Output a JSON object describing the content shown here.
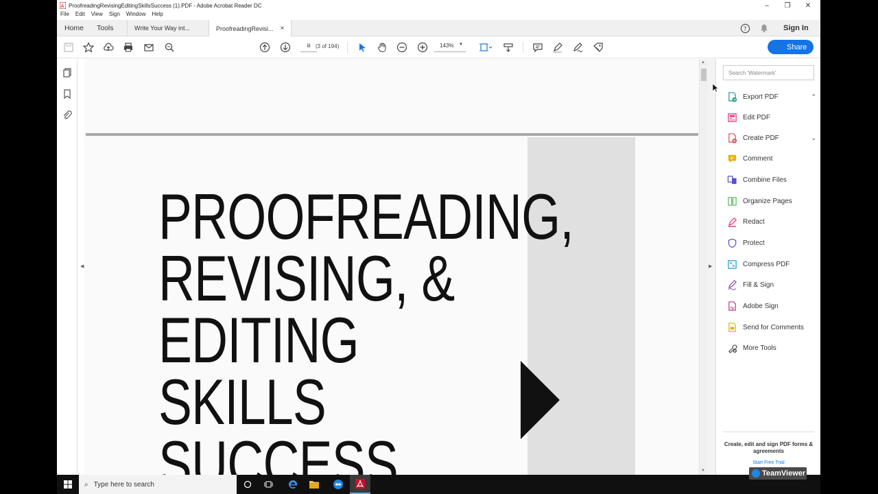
{
  "window": {
    "title": "ProofreadingRevisingEditingSkillsSuccess (1).PDF - Adobe Acrobat Reader DC",
    "minimize": "–",
    "maximize": "❐",
    "close": "✕"
  },
  "menu": [
    "File",
    "Edit",
    "View",
    "Sign",
    "Window",
    "Help"
  ],
  "tabs": {
    "home": "Home",
    "tools": "Tools",
    "documents": [
      {
        "label": "Write Your Way int...",
        "active": false
      },
      {
        "label": "ProofreadingRevisi...",
        "active": true,
        "close": "×"
      }
    ],
    "sign_in": "Sign In"
  },
  "toolbar": {
    "page_input": "iii",
    "page_count": "(3 of 194)",
    "zoom": "143%",
    "share": "Share"
  },
  "document": {
    "title_lines": [
      "PROOFREADING,",
      "REVISING, &",
      "EDITING",
      "SKILLS",
      "SUCCESS"
    ]
  },
  "right_panel": {
    "search_placeholder": "Search 'Watermark'",
    "tools": [
      {
        "label": "Export PDF",
        "icon": "export-pdf-icon",
        "color": "#1a9c8c",
        "chevron": "⌃"
      },
      {
        "label": "Edit PDF",
        "icon": "edit-pdf-icon",
        "color": "#e0337a",
        "chevron": ""
      },
      {
        "label": "Create PDF",
        "icon": "create-pdf-icon",
        "color": "#e34850",
        "chevron": "⌄"
      },
      {
        "label": "Comment",
        "icon": "comment-icon",
        "color": "#e8b000",
        "chevron": ""
      },
      {
        "label": "Combine Files",
        "icon": "combine-files-icon",
        "color": "#5a4fcf",
        "chevron": ""
      },
      {
        "label": "Organize Pages",
        "icon": "organize-pages-icon",
        "color": "#5cb85c",
        "chevron": ""
      },
      {
        "label": "Redact",
        "icon": "redact-icon",
        "color": "#e0337a",
        "chevron": ""
      },
      {
        "label": "Protect",
        "icon": "protect-icon",
        "color": "#5a4fcf",
        "chevron": ""
      },
      {
        "label": "Compress PDF",
        "icon": "compress-pdf-icon",
        "color": "#1a9ccf",
        "chevron": ""
      },
      {
        "label": "Fill & Sign",
        "icon": "fill-sign-icon",
        "color": "#8e44ad",
        "chevron": ""
      },
      {
        "label": "Adobe Sign",
        "icon": "adobe-sign-icon",
        "color": "#c2378a",
        "chevron": ""
      },
      {
        "label": "Send for Comments",
        "icon": "send-for-comments-icon",
        "color": "#e8b000",
        "chevron": ""
      },
      {
        "label": "More Tools",
        "icon": "more-tools-icon",
        "color": "#555555",
        "chevron": ""
      }
    ],
    "promo": "Create, edit and sign PDF forms & agreements",
    "trial": "Start Free Trial"
  },
  "teamviewer": "TeamViewer",
  "taskbar": {
    "search_placeholder": "Type here to search"
  },
  "colors": {
    "accent": "#1473e6"
  }
}
